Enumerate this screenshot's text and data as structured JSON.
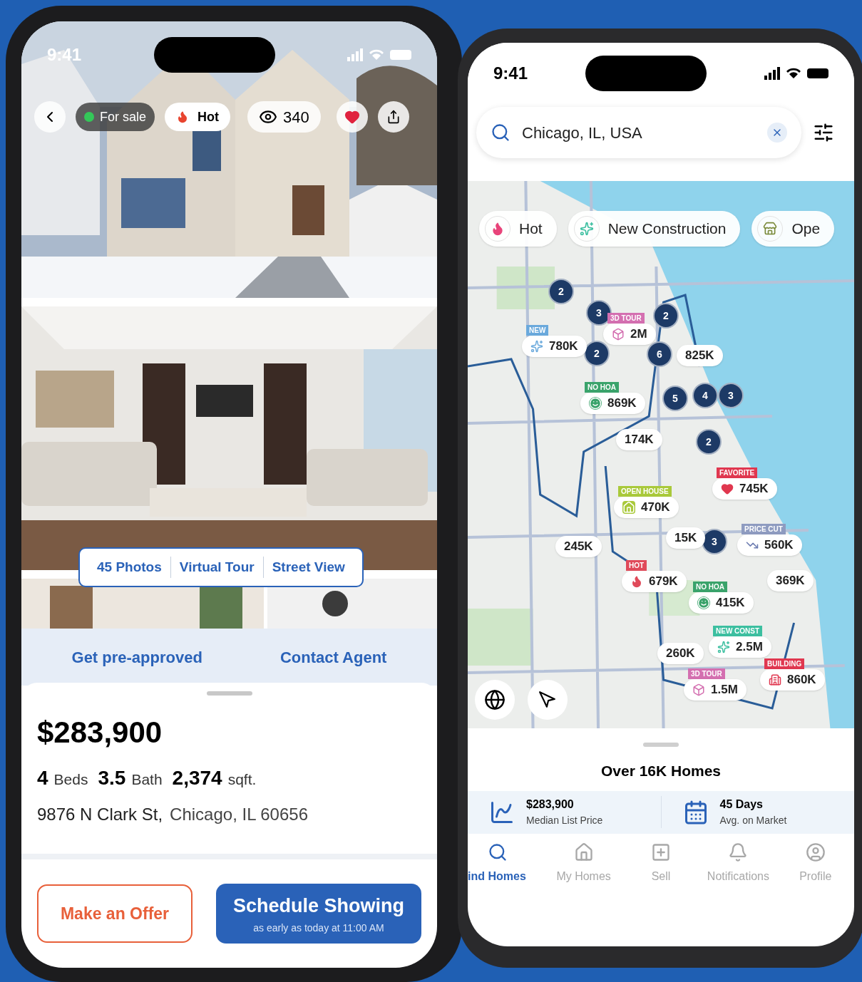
{
  "left_phone": {
    "status_time": "9:41",
    "overlay": {
      "status_badge": {
        "label": "For sale",
        "color": "#34c759"
      },
      "hot_badge": "Hot",
      "views": "340",
      "favorited": true
    },
    "media_tabs": [
      "45 Photos",
      "Virtual Tour",
      "Street View"
    ],
    "links": [
      "Get pre-approved",
      "Contact Agent"
    ],
    "listing": {
      "price": "$283,900",
      "facts": [
        {
          "value": "4",
          "unit": "Beds"
        },
        {
          "value": "3.5",
          "unit": "Bath"
        },
        {
          "value": "2,374",
          "unit": "sqft."
        }
      ],
      "street": "9876 N Clark St,",
      "city": "Chicago, IL 60656"
    },
    "actions": {
      "offer": "Make an Offer",
      "schedule": "Schedule Showing",
      "schedule_note": "as early as today at 11:00 AM"
    }
  },
  "right_phone": {
    "status_time": "9:41",
    "search": {
      "value": "Chicago, IL, USA"
    },
    "chips": [
      {
        "kind": "hot",
        "label": "Hot"
      },
      {
        "kind": "new_construction",
        "label": "New Construction"
      },
      {
        "kind": "open_house",
        "label": "Ope"
      }
    ],
    "clusters": [
      "2",
      "3",
      "2",
      "2",
      "6",
      "5",
      "4",
      "3",
      "2",
      "3"
    ],
    "pins": [
      {
        "kind": "new",
        "tag": "NEW",
        "color": "#6aa9dc",
        "price": "780K"
      },
      {
        "kind": "tour",
        "tag": "3D TOUR",
        "color": "#d46fb0",
        "price": "2M"
      },
      {
        "price": "825K"
      },
      {
        "kind": "no_hoa",
        "tag": "NO HOA",
        "color": "#3aa36b",
        "price": "869K"
      },
      {
        "price": "174K"
      },
      {
        "kind": "favorite",
        "tag": "FAVORITE",
        "color": "#e0374f",
        "price": "745K"
      },
      {
        "kind": "open_house",
        "tag": "OPEN HOUSE",
        "color": "#a9c93a",
        "price": "470K"
      },
      {
        "price": "245K"
      },
      {
        "price": "15K"
      },
      {
        "kind": "price_cut",
        "tag": "PRICE CUT",
        "color": "#8e9bc0",
        "price": "560K"
      },
      {
        "price": "369K"
      },
      {
        "kind": "hot",
        "tag": "HOT",
        "color": "#e04a5a",
        "price": "679K"
      },
      {
        "kind": "no_hoa",
        "tag": "NO HOA",
        "color": "#3aa36b",
        "price": "415K"
      },
      {
        "kind": "new_construction",
        "tag": "NEW CONST",
        "color": "#3cbfa0",
        "price": "2.5M"
      },
      {
        "price": "260K"
      },
      {
        "kind": "building",
        "tag": "BUILDING",
        "color": "#e0374f",
        "price": "860K"
      },
      {
        "kind": "tour",
        "tag": "3D TOUR",
        "color": "#d46fb0",
        "price": "1.5M"
      }
    ],
    "sheet_title": "Over 16K Homes",
    "stats": [
      {
        "kind": "price",
        "value": "$283,900",
        "label": "Median List Price"
      },
      {
        "kind": "days",
        "value": "45 Days",
        "label": "Avg. on Market"
      }
    ],
    "nav": [
      {
        "kind": "search",
        "label": "ind Homes",
        "selected": true
      },
      {
        "kind": "home",
        "label": "My Homes",
        "selected": false
      },
      {
        "kind": "sell",
        "label": "Sell",
        "selected": false
      },
      {
        "kind": "bell",
        "label": "Notifications",
        "selected": false
      },
      {
        "kind": "profile",
        "label": "Profile",
        "selected": false
      }
    ]
  }
}
